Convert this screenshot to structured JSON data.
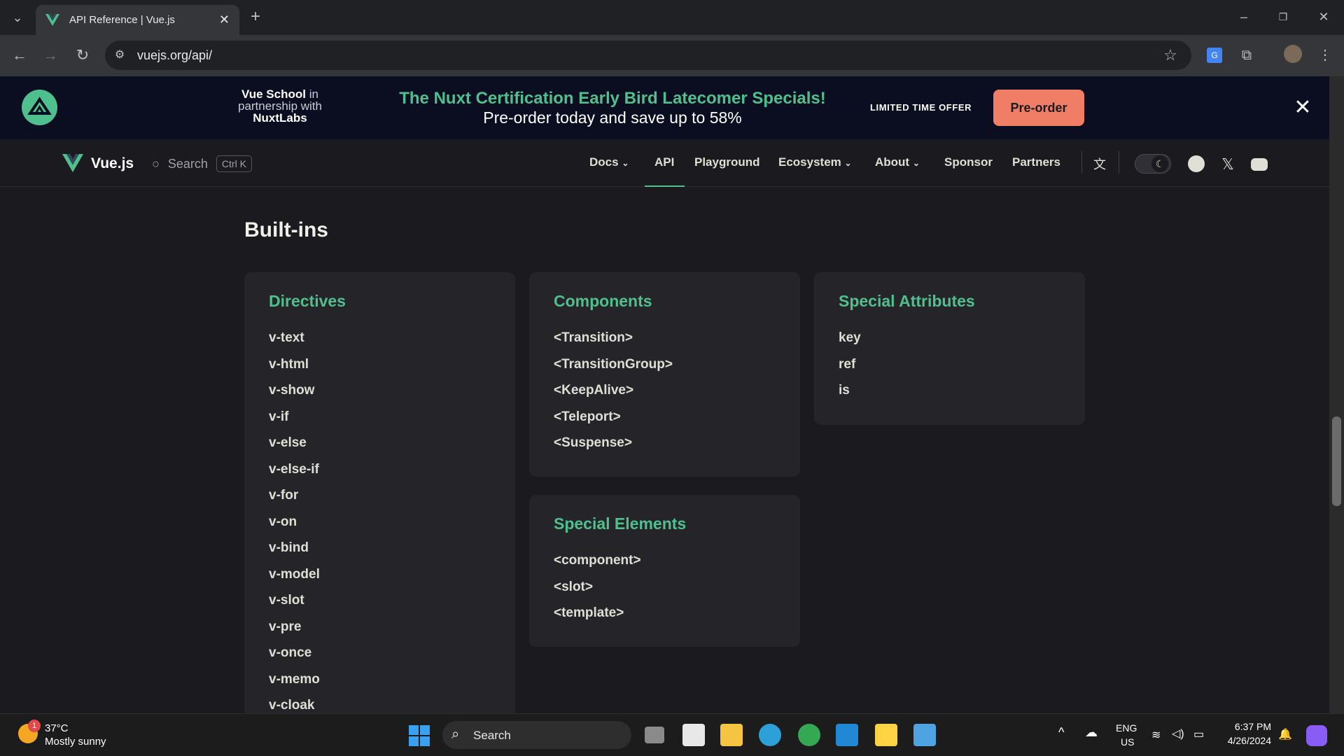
{
  "browser": {
    "tab_title": "API Reference | Vue.js",
    "url": "vuejs.org/api/"
  },
  "banner": {
    "vue_school": "Vue School",
    "in_partnership": " in",
    "partnership_with": "partnership with",
    "nuxtlabs": "NuxtLabs",
    "headline": "The Nuxt Certification Early Bird Latecomer Specials!",
    "subline": "Pre-order today and save up to 58%",
    "limited": "LIMITED TIME OFFER",
    "cta": "Pre-order"
  },
  "nav": {
    "brand": "Vue.js",
    "search_label": "Search",
    "search_kbd": "Ctrl K",
    "links": [
      "Docs",
      "API",
      "Playground",
      "Ecosystem",
      "About",
      "Sponsor",
      "Partners"
    ],
    "accent": "#4fc08d"
  },
  "main": {
    "section_title": "Built-ins",
    "directives": {
      "title": "Directives",
      "items": [
        "v-text",
        "v-html",
        "v-show",
        "v-if",
        "v-else",
        "v-else-if",
        "v-for",
        "v-on",
        "v-bind",
        "v-model",
        "v-slot",
        "v-pre",
        "v-once",
        "v-memo",
        "v-cloak"
      ]
    },
    "components": {
      "title": "Components",
      "items": [
        "<Transition>",
        "<TransitionGroup>",
        "<KeepAlive>",
        "<Teleport>",
        "<Suspense>"
      ]
    },
    "special_elements": {
      "title": "Special Elements",
      "items": [
        "<component>",
        "<slot>",
        "<template>"
      ]
    },
    "special_attributes": {
      "title": "Special Attributes",
      "items": [
        "key",
        "ref",
        "is"
      ]
    }
  },
  "taskbar": {
    "badge": "1",
    "temp": "37°C",
    "condition": "Mostly sunny",
    "search_label": "Search",
    "lang1": "ENG",
    "lang2": "US",
    "time": "6:37 PM",
    "date": "4/26/2024"
  }
}
